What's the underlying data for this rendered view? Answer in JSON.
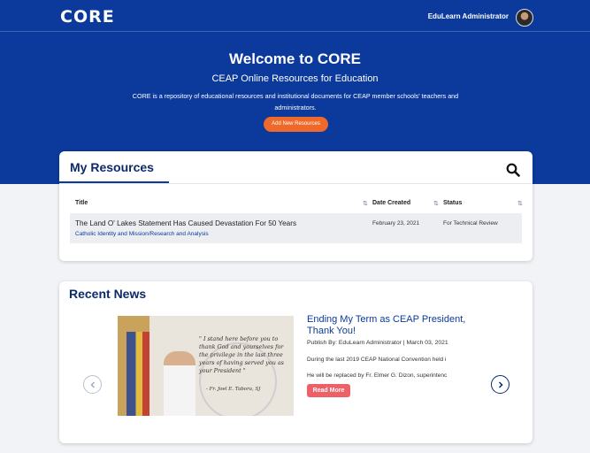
{
  "header": {
    "logo_text": "CORE",
    "user_name": "EduLearn Administrator"
  },
  "hero": {
    "title": "Welcome to CORE",
    "subtitle": "CEAP Online Resources for Education",
    "description": "CORE is a repository of educational resources and institutional documents for CEAP member schools' teachers and administrators.",
    "add_button_label": "Add New Resources"
  },
  "resources": {
    "title": "My Resources",
    "columns": [
      "Title",
      "Date Created",
      "Status"
    ],
    "rows": [
      {
        "title": "The Land O' Lakes Statement Has Caused Devastation For 50 Years",
        "category": "Catholic Identity and Mission/Research and Analysis",
        "date": "February 23, 2021",
        "status": "For Technical Review"
      }
    ]
  },
  "news": {
    "title": "Recent News",
    "items": [
      {
        "headline": "Ending My Term as CEAP President, Thank You!",
        "byline": "Publish By: EduLearn Administrator | March 03, 2021",
        "excerpt_1": "During the last 2019 CEAP National Convention held i",
        "excerpt_2": "He will be replaced by Fr. Elmer G. Dizon, superintenc",
        "read_more_label": "Read More",
        "image_quote": "\" I stand here before you to thank God and yourselves for the privilege in the last three years of having served you as your President \"",
        "image_signature": "- Fr. Joel E. Tabora, SJ"
      }
    ]
  },
  "colors": {
    "hero_bg": "#0b3a9c",
    "accent_orange": "#ef6a2a",
    "read_more": "#ef5f66",
    "title_navy": "#0b2a6b"
  }
}
